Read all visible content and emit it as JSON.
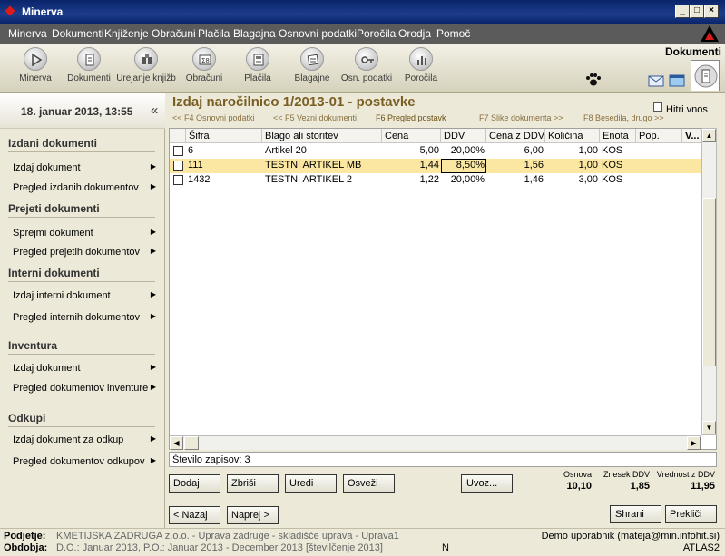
{
  "window": {
    "title": "Minerva"
  },
  "menu": [
    "Minerva",
    "Dokumenti",
    "Knjiženje",
    "Obračuni",
    "Plačila",
    "Blagajna",
    "Osnovni podatki",
    "Poročila",
    "Orodja",
    "Pomoč"
  ],
  "toolbar": {
    "items": [
      {
        "label": "Minerva",
        "icon": "play-icon"
      },
      {
        "label": "Dokumenti",
        "icon": "document-icon"
      },
      {
        "label": "Urejanje knjižb",
        "icon": "book-icon"
      },
      {
        "label": "Obračuni",
        "icon": "calculator-icon"
      },
      {
        "label": "Plačila",
        "icon": "payment-icon"
      },
      {
        "label": "Blagajne",
        "icon": "cashbox-icon"
      },
      {
        "label": "Osn. podatki",
        "icon": "key-icon"
      },
      {
        "label": "Poročila",
        "icon": "chart-icon"
      }
    ],
    "active_tab": "Dokumenti"
  },
  "sidebar": {
    "datetime": "18. januar 2013, 13:55",
    "collapse": "«",
    "groups": [
      {
        "title": "Izdani dokumenti",
        "items": [
          "Izdaj dokument",
          "Pregled izdanih dokumentov"
        ]
      },
      {
        "title": "Prejeti dokumenti",
        "items": [
          "Sprejmi dokument",
          "Pregled prejetih dokumentov"
        ]
      },
      {
        "title": "Interni dokumenti",
        "items": [
          "Izdaj interni dokument",
          "Pregled internih dokumentov"
        ]
      },
      {
        "title": "Inventura",
        "items": [
          "Izdaj dokument",
          "Pregled dokumentov inventure"
        ]
      },
      {
        "title": "Odkupi",
        "items": [
          "Izdaj dokument za odkup",
          "Pregled dokumentov odkupov"
        ]
      }
    ]
  },
  "main": {
    "title": "Izdaj naročilnico 1/2013-01 - postavke",
    "quick_entry": "Hitri vnos",
    "fkeys": [
      "<< F4 Osnovni podatki",
      "<< F5 Vezni dokumenti",
      "F6 Pregled postavk",
      "F7 Slike dokumenta >>",
      "F8 Besedila, drugo >>"
    ],
    "columns": [
      "Šifra",
      "Blago ali storitev",
      "Cena",
      "DDV",
      "Cena z DDV",
      "Količina",
      "Enota",
      "Pop.",
      "V..."
    ],
    "rows": [
      {
        "sifra": "6",
        "blago": "Artikel 20",
        "cena": "5,00",
        "ddv": "20,00%",
        "cena_ddv": "6,00",
        "kolicina": "1,00",
        "enota": "KOS"
      },
      {
        "sifra": "111",
        "blago": "TESTNI ARTIKEL MB",
        "cena": "1,44",
        "ddv": "8,50%",
        "cena_ddv": "1,56",
        "kolicina": "1,00",
        "enota": "KOS"
      },
      {
        "sifra": "1432",
        "blago": "TESTNI ARTIKEL 2",
        "cena": "1,22",
        "ddv": "20,00%",
        "cena_ddv": "1,46",
        "kolicina": "3,00",
        "enota": "KOS"
      }
    ],
    "record_count": "Število zapisov: 3",
    "buttons": {
      "add": "Dodaj",
      "delete": "Zbriši",
      "edit": "Uredi",
      "refresh": "Osveži",
      "import": "Uvoz...",
      "back": "< Nazaj",
      "next": "Naprej >",
      "save": "Shrani",
      "cancel": "Prekliči"
    },
    "totals": [
      {
        "label": "Osnova",
        "value": "10,10"
      },
      {
        "label": "Znesek DDV",
        "value": "1,85"
      },
      {
        "label": "Vrednost z DDV",
        "value": "11,95"
      }
    ]
  },
  "status": {
    "company_label": "Podjetje:",
    "company": "KMETIJSKA ZADRUGA z.o.o. - Uprava zadruge - skladišče uprava - Uprava1",
    "period_label": "Obdobja:",
    "period": "D.O.: Januar 2013, P.O.: Januar 2013 - December 2013 [številčenje 2013]",
    "mode": "N",
    "user": "Demo uporabnik (mateja@min.infohit.si)",
    "db": "ATLAS2"
  },
  "colors": {
    "highlight_row": "#fbe7a1",
    "accent": "#7a5f24",
    "titlebar": "#0a246a"
  }
}
